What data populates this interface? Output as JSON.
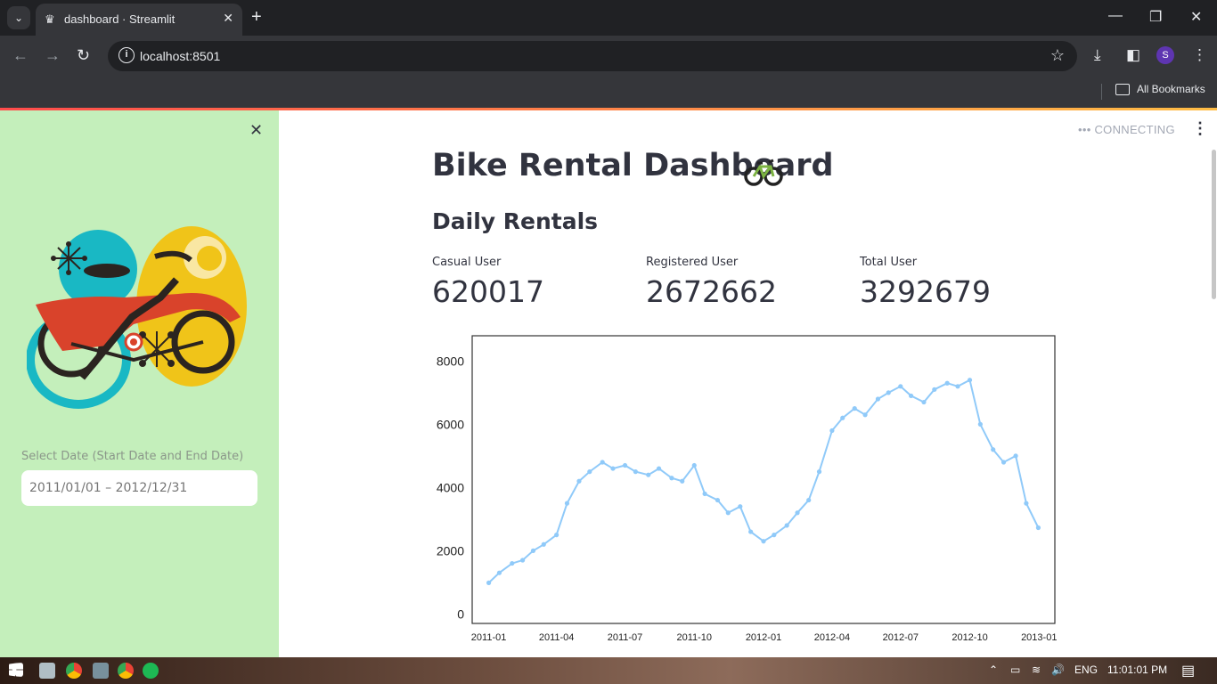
{
  "browser": {
    "tab_title": "dashboard · Streamlit",
    "url": "localhost:8501",
    "bookmarks_label": "All Bookmarks",
    "profile_initial": "S"
  },
  "sidebar": {
    "date_label": "Select Date (Start Date and End Date)",
    "date_value": "2011/01/01 – 2012/12/31"
  },
  "main": {
    "status": "CONNECTING",
    "title": "Bike Rental Dashboard",
    "subheader": "Daily Rentals",
    "metrics": [
      {
        "label": "Casual User",
        "value": "620017"
      },
      {
        "label": "Registered User",
        "value": "2672662"
      },
      {
        "label": "Total User",
        "value": "3292679"
      }
    ]
  },
  "taskbar": {
    "lang": "ENG",
    "time": "11:01:01 PM"
  },
  "colors": {
    "sidebar_bg": "#c4efbb",
    "line": "#90caf9",
    "text": "#31333f"
  },
  "chart_data": {
    "type": "line",
    "title": "",
    "xlabel": "",
    "ylabel": "",
    "ylim": [
      -300,
      8800
    ],
    "yticks": [
      0,
      2000,
      4000,
      6000,
      8000
    ],
    "xticks": [
      "2011-01",
      "2011-04",
      "2011-07",
      "2011-10",
      "2012-01",
      "2012-04",
      "2012-07",
      "2012-10",
      "2013-01"
    ],
    "series": [
      {
        "x": [
          "2011-01-01",
          "2011-01-15",
          "2011-02-01",
          "2011-02-15",
          "2011-03-01",
          "2011-03-15",
          "2011-04-01",
          "2011-04-15",
          "2011-05-01",
          "2011-05-15",
          "2011-06-01",
          "2011-06-15",
          "2011-07-01",
          "2011-07-15",
          "2011-08-01",
          "2011-08-15",
          "2011-09-01",
          "2011-09-15",
          "2011-10-01",
          "2011-10-15",
          "2011-11-01",
          "2011-11-15",
          "2011-12-01",
          "2011-12-15",
          "2012-01-01",
          "2012-01-15",
          "2012-02-01",
          "2012-02-15",
          "2012-03-01",
          "2012-03-15",
          "2012-04-01",
          "2012-04-15",
          "2012-05-01",
          "2012-05-15",
          "2012-06-01",
          "2012-06-15",
          "2012-07-01",
          "2012-07-15",
          "2012-08-01",
          "2012-08-15",
          "2012-09-01",
          "2012-09-15",
          "2012-10-01",
          "2012-10-15",
          "2012-11-01",
          "2012-11-15",
          "2012-12-01",
          "2012-12-15",
          "2012-12-31"
        ],
        "values": [
          985,
          1300,
          1600,
          1700,
          2000,
          2200,
          2500,
          3500,
          4200,
          4500,
          4800,
          4600,
          4700,
          4500,
          4400,
          4600,
          4300,
          4200,
          4700,
          3800,
          3600,
          3200,
          3400,
          2600,
          2300,
          2500,
          2800,
          3200,
          3600,
          4500,
          5800,
          6200,
          6500,
          6300,
          6800,
          7000,
          7200,
          6900,
          6700,
          7100,
          7300,
          7200,
          7400,
          6000,
          5200,
          4800,
          5000,
          3500,
          2729
        ]
      }
    ]
  }
}
